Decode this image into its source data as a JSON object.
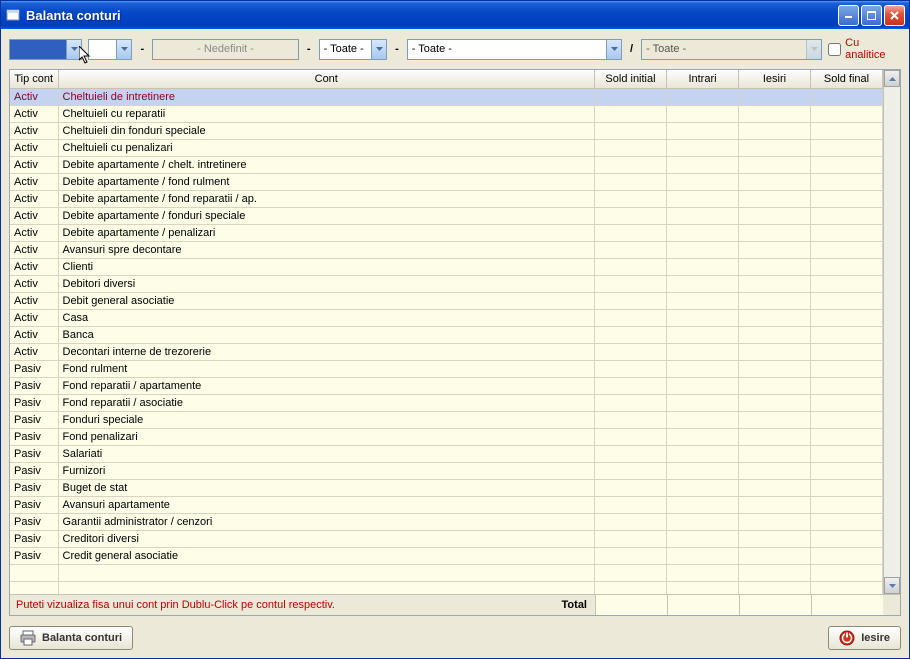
{
  "window": {
    "title": "Balanta conturi"
  },
  "toolbar": {
    "combo1": "",
    "combo2": "- Nedefinit -",
    "combo3": "- Toate -",
    "combo4": "- Toate -",
    "combo5": "- Toate -",
    "separator": "/",
    "checkbox_label": "Cu analitice"
  },
  "columns": {
    "tip": "Tip cont",
    "cont": "Cont",
    "sold_initial": "Sold initial",
    "intrari": "Intrari",
    "iesiri": "Iesiri",
    "sold_final": "Sold final"
  },
  "rows": [
    {
      "tip": "Activ",
      "cont": "Cheltuieli de intretinere",
      "selected": true
    },
    {
      "tip": "Activ",
      "cont": "Cheltuieli cu reparatii"
    },
    {
      "tip": "Activ",
      "cont": "Cheltuieli din fonduri speciale"
    },
    {
      "tip": "Activ",
      "cont": "Cheltuieli cu penalizari"
    },
    {
      "tip": "Activ",
      "cont": "Debite apartamente / chelt. intretinere"
    },
    {
      "tip": "Activ",
      "cont": "Debite apartamente / fond rulment"
    },
    {
      "tip": "Activ",
      "cont": "Debite apartamente / fond reparatii / ap."
    },
    {
      "tip": "Activ",
      "cont": "Debite apartamente / fonduri speciale"
    },
    {
      "tip": "Activ",
      "cont": "Debite apartamente / penalizari"
    },
    {
      "tip": "Activ",
      "cont": "Avansuri spre decontare"
    },
    {
      "tip": "Activ",
      "cont": "Clienti"
    },
    {
      "tip": "Activ",
      "cont": "Debitori diversi"
    },
    {
      "tip": "Activ",
      "cont": "Debit general asociatie"
    },
    {
      "tip": "Activ",
      "cont": "Casa"
    },
    {
      "tip": "Activ",
      "cont": "Banca"
    },
    {
      "tip": "Activ",
      "cont": "Decontari interne de trezorerie"
    },
    {
      "tip": "Pasiv",
      "cont": "Fond rulment"
    },
    {
      "tip": "Pasiv",
      "cont": "Fond reparatii / apartamente"
    },
    {
      "tip": "Pasiv",
      "cont": "Fond reparatii / asociatie"
    },
    {
      "tip": "Pasiv",
      "cont": "Fonduri speciale"
    },
    {
      "tip": "Pasiv",
      "cont": "Fond penalizari"
    },
    {
      "tip": "Pasiv",
      "cont": "Salariati"
    },
    {
      "tip": "Pasiv",
      "cont": "Furnizori"
    },
    {
      "tip": "Pasiv",
      "cont": "Buget de stat"
    },
    {
      "tip": "Pasiv",
      "cont": "Avansuri apartamente"
    },
    {
      "tip": "Pasiv",
      "cont": "Garantii administrator / cenzori"
    },
    {
      "tip": "Pasiv",
      "cont": "Creditori diversi"
    },
    {
      "tip": "Pasiv",
      "cont": "Credit general asociatie"
    }
  ],
  "empty_rows": 2,
  "footer": {
    "hint": "Puteti vizualiza fisa unui cont prin Dublu-Click pe contul respectiv.",
    "total_label": "Total"
  },
  "buttons": {
    "print": "Balanta conturi",
    "exit": "Iesire"
  }
}
